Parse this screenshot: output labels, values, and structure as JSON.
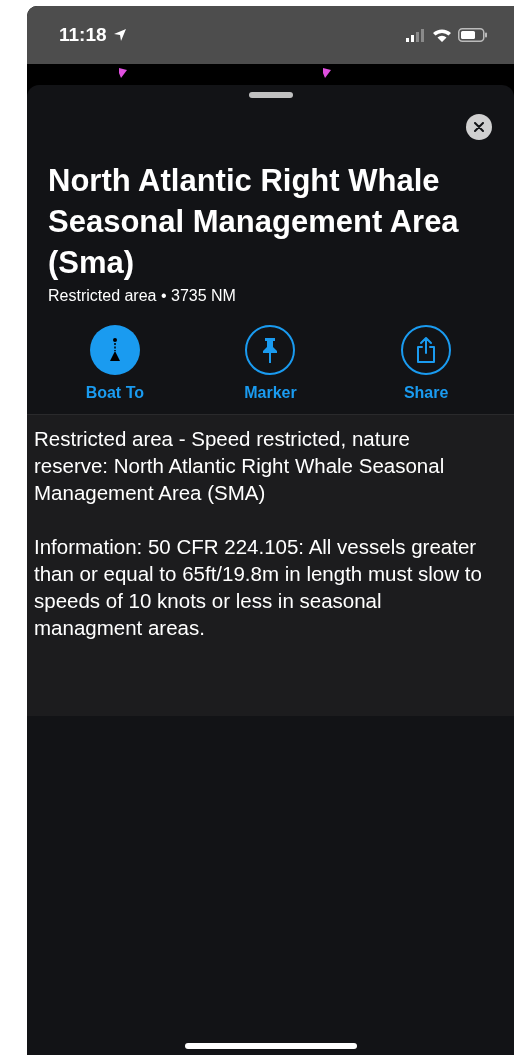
{
  "status_bar": {
    "time": "11:18"
  },
  "sheet": {
    "title": "North Atlantic Right Whale Seasonal Management Area (Sma)",
    "subtitle": "Restricted area • 3735 NM"
  },
  "actions": [
    {
      "label": "Boat To",
      "kind": "filled"
    },
    {
      "label": "Marker",
      "kind": "outline"
    },
    {
      "label": "Share",
      "kind": "outline"
    }
  ],
  "description": [
    "Restricted area - Speed restricted, nature reserve: North Atlantic Right Whale Seasonal Management Area (SMA)",
    "Information: 50 CFR 224.105: All vessels greater than or equal to 65ft/19.8m in length must slow to speeds of 10 knots or less in seasonal managment areas."
  ]
}
